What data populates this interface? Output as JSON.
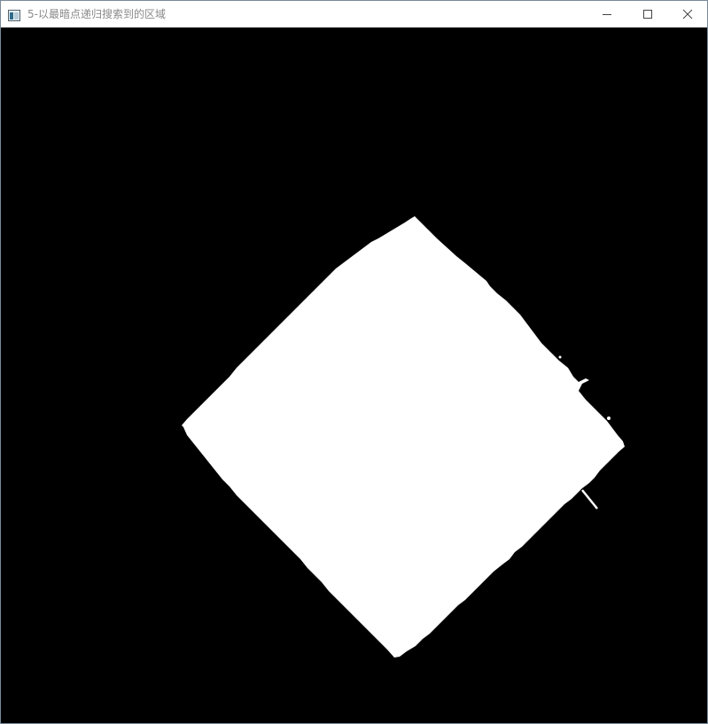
{
  "window": {
    "title": "5-以最暗点递归搜索到的区域",
    "icon": "opencv-window-icon",
    "controls": {
      "minimize_icon": "minimize-icon",
      "maximize_icon": "maximize-icon",
      "close_icon": "close-icon"
    }
  },
  "image": {
    "description_kind": "binary-region-mask",
    "background_color": "#000000",
    "region_color": "#ffffff"
  }
}
